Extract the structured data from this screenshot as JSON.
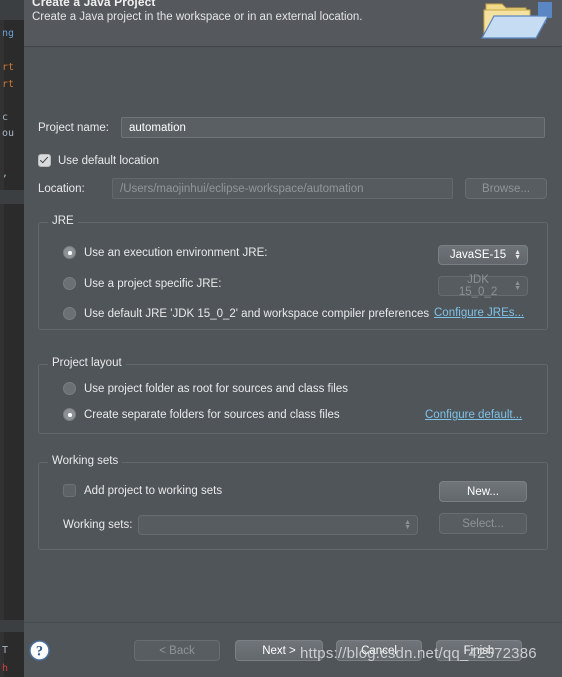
{
  "window": {
    "title": "Create a Java Project",
    "subtitle": "Create a Java project in the workspace or in an external location.",
    "banner_icon": "new-java-project-folder-icon"
  },
  "project": {
    "name_label": "Project name:",
    "name_value": "automation",
    "use_default_location_label": "Use default location",
    "use_default_location_checked": true,
    "location_label": "Location:",
    "location_value": "/Users/maojinhui/eclipse-workspace/automation",
    "browse_label": "Browse..."
  },
  "jre": {
    "group_title": "JRE",
    "options": [
      {
        "label": "Use an execution environment JRE:",
        "selected": true
      },
      {
        "label": "Use a project specific JRE:",
        "selected": false
      },
      {
        "label": "Use default JRE 'JDK 15_0_2' and workspace compiler preferences",
        "selected": false
      }
    ],
    "execution_env_value": "JavaSE-15",
    "project_jre_value": "JDK 15_0_2",
    "configure_link": "Configure JREs..."
  },
  "project_layout": {
    "group_title": "Project layout",
    "options": [
      {
        "label": "Use project folder as root for sources and class files",
        "selected": false
      },
      {
        "label": "Create separate folders for sources and class files",
        "selected": true
      }
    ],
    "configure_link": "Configure default..."
  },
  "working_sets": {
    "group_title": "Working sets",
    "add_label": "Add project to working sets",
    "add_checked": false,
    "new_label": "New...",
    "sets_label": "Working sets:",
    "sets_value": "",
    "select_label": "Select..."
  },
  "footer": {
    "help_icon": "help-question-icon",
    "back_label": "< Back",
    "next_label": "Next >",
    "cancel_label": "Cancel",
    "finish_label": "Finish",
    "back_enabled": false,
    "next_enabled": true
  },
  "watermark": {
    "text": "https://blog.csdn.net/qq_42572386"
  },
  "background_editor": {
    "fragments": [
      "ng",
      "rt",
      "rt",
      "c",
      "ou",
      ",",
      "T",
      "h"
    ]
  },
  "colors": {
    "dialog_bg": "#50555a",
    "link": "#7ec2e8",
    "accent_folder": "#f0d98a",
    "help_blue": "#3a6ea5"
  }
}
